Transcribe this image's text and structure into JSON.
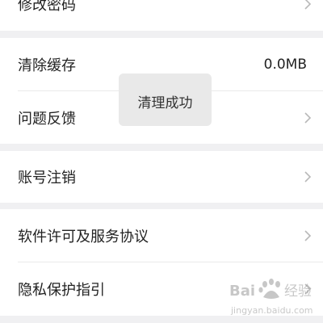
{
  "settings": {
    "change_password": "修改密码",
    "clear_cache": {
      "label": "清除缓存",
      "value": "0.0MB"
    },
    "feedback": "问题反馈",
    "cancel_account": "账号注销",
    "license_agreement": "软件许可及服务协议",
    "privacy_guide": "隐私保护指引"
  },
  "toast": {
    "text": "清理成功"
  },
  "watermark": {
    "text": "Bai 经验",
    "url": "jingyan.baidu.com"
  }
}
